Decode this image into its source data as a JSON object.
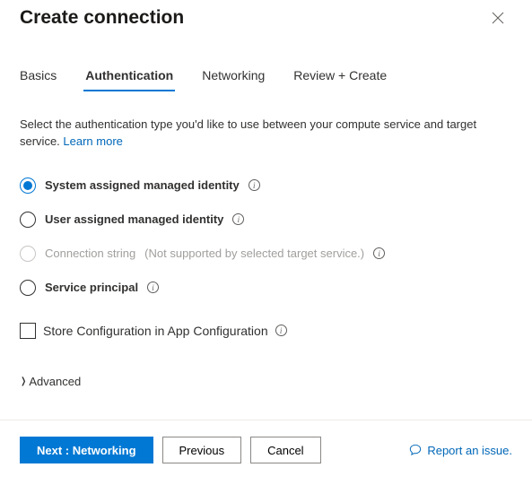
{
  "header": {
    "title": "Create connection"
  },
  "tabs": {
    "items": [
      {
        "label": "Basics",
        "active": false
      },
      {
        "label": "Authentication",
        "active": true
      },
      {
        "label": "Networking",
        "active": false
      },
      {
        "label": "Review + Create",
        "active": false
      }
    ]
  },
  "description": {
    "text": "Select the authentication type you'd like to use between your compute service and target service. ",
    "learn_more": "Learn more"
  },
  "auth_options": [
    {
      "label": "System assigned managed identity",
      "selected": true,
      "disabled": false,
      "note": ""
    },
    {
      "label": "User assigned managed identity",
      "selected": false,
      "disabled": false,
      "note": ""
    },
    {
      "label": "Connection string",
      "selected": false,
      "disabled": true,
      "note": "(Not supported by selected target service.)"
    },
    {
      "label": "Service principal",
      "selected": false,
      "disabled": false,
      "note": ""
    }
  ],
  "store_config": {
    "label": "Store Configuration in App Configuration",
    "checked": false
  },
  "advanced": {
    "label": "Advanced"
  },
  "footer": {
    "next_label": "Next : Networking",
    "previous_label": "Previous",
    "cancel_label": "Cancel",
    "report_label": "Report an issue."
  }
}
